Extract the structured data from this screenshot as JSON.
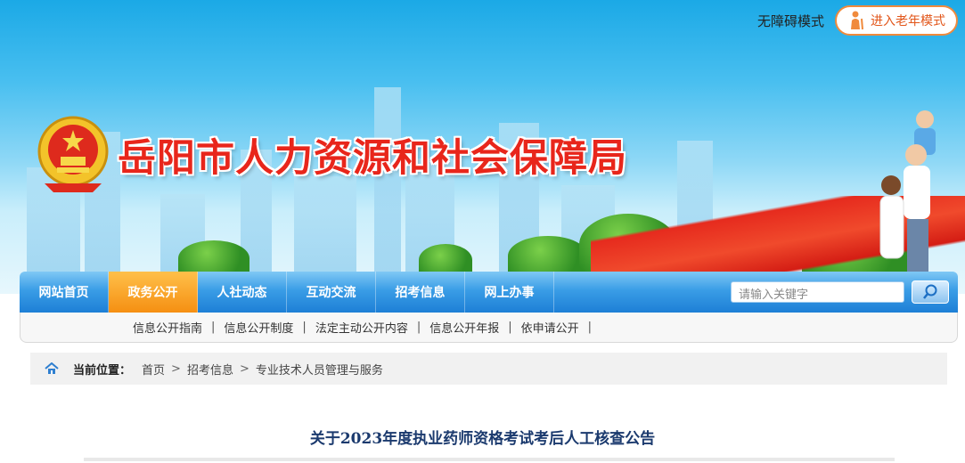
{
  "header": {
    "site_title": "岳阳市人力资源和社会保障局",
    "accessibility_label": "无障碍模式",
    "elder_mode_label": "进入老年模式"
  },
  "nav": {
    "items": [
      {
        "label": "网站首页",
        "active": false
      },
      {
        "label": "政务公开",
        "active": true
      },
      {
        "label": "人社动态",
        "active": false
      },
      {
        "label": "互动交流",
        "active": false
      },
      {
        "label": "招考信息",
        "active": false
      },
      {
        "label": "网上办事",
        "active": false
      }
    ],
    "search_placeholder": "请输入关键字"
  },
  "subnav": {
    "items": [
      "信息公开指南",
      "信息公开制度",
      "法定主动公开内容",
      "信息公开年报",
      "依申请公开"
    ]
  },
  "breadcrumb": {
    "label": "当前位置：",
    "items": [
      "首页",
      "招考信息",
      "专业技术人员管理与服务"
    ]
  },
  "article": {
    "title": "关于2023年度执业药师资格考试考后人工核查公告"
  },
  "colors": {
    "accent": "#1d7fd6",
    "active_tab": "#f58f12",
    "title_red": "#e8261b"
  }
}
